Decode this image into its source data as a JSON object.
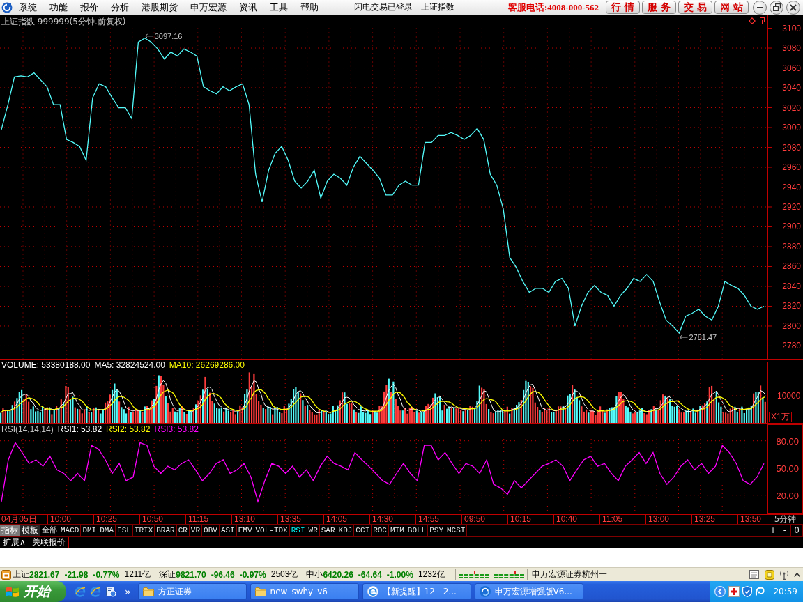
{
  "menu_bar": {
    "items": [
      "系统",
      "功能",
      "报价",
      "分析",
      "港股期货",
      "申万宏源",
      "资讯",
      "工具",
      "帮助"
    ],
    "status_texts": [
      "闪电交易已登录",
      "上证指数"
    ],
    "hotline": "客服电话:4008-000-562",
    "buttons": [
      "行 情",
      "服 务",
      "交 易",
      "网 站"
    ]
  },
  "price_panel": {
    "chart_data": {
      "type": "line",
      "title": "上证指数 999999(5分钟.前复权)",
      "series": [
        {
          "color": "#54fcfc",
          "values": [
            2998,
            3023,
            3051,
            3052,
            3051,
            3055,
            3048,
            3041,
            3023,
            3023,
            2988,
            2985,
            2981,
            2967,
            3030,
            3044,
            3041,
            3030,
            3020,
            3020,
            3009,
            3086,
            3090,
            3086,
            3079,
            3069,
            3076,
            3072,
            3079,
            3076,
            3072,
            3041,
            3037,
            3034,
            3041,
            3037,
            3041,
            3044,
            3023,
            2953,
            2925,
            2957,
            2974,
            2981,
            2967,
            2946,
            2939,
            2946,
            2957,
            2929,
            2946,
            2953,
            2949,
            2942,
            2960,
            2971,
            2964,
            2957,
            2949,
            2932,
            2932,
            2942,
            2946,
            2942,
            2942,
            2985,
            2985,
            2992,
            2992,
            2995,
            2992,
            2988,
            2992,
            2999,
            2988,
            2953,
            2942,
            2918,
            2869,
            2859,
            2845,
            2834,
            2838,
            2838,
            2834,
            2845,
            2848,
            2838,
            2800,
            2820,
            2834,
            2841,
            2834,
            2831,
            2820,
            2831,
            2838,
            2848,
            2845,
            2852,
            2845,
            2824,
            2806,
            2800,
            2793,
            2810,
            2813,
            2817,
            2810,
            2806,
            2820,
            2845,
            2841,
            2838,
            2831,
            2820,
            2817,
            2820
          ]
        }
      ],
      "ylim": [
        2767,
        3113
      ],
      "yticks": [
        3100,
        3080,
        3060,
        3040,
        3020,
        3000,
        2980,
        2960,
        2940,
        2920,
        2900,
        2880,
        2860,
        2840,
        2820,
        2800,
        2780
      ],
      "grid": true,
      "annotations": [
        "3097.16",
        "2781.47"
      ]
    }
  },
  "volume_panel": {
    "legend": [
      {
        "text": "VOLUME: 53380188.00",
        "color": "#ffffff"
      },
      {
        "text": "MA5: 32824524.00",
        "color": "#ffffff"
      },
      {
        "text": "MA10: 26269286.00",
        "color": "#ffff00"
      }
    ],
    "axis_label": "10000",
    "unit": "X1万"
  },
  "rsi_panel": {
    "legend": [
      {
        "text": "RSI(14,14,14)",
        "color": "#c0c0c0"
      },
      {
        "text": "RSI1: 53.82",
        "color": "#ffffff"
      },
      {
        "text": "RSI2: 53.82",
        "color": "#ffff00"
      },
      {
        "text": "RSI3: 53.82",
        "color": "#ff00ff"
      }
    ],
    "chart_data": {
      "type": "line",
      "series": [
        {
          "color": "#ff00ff",
          "values": [
            13,
            59,
            78,
            67,
            55,
            59,
            52,
            63,
            48,
            44,
            36,
            44,
            36,
            75,
            71,
            59,
            44,
            55,
            36,
            40,
            78,
            75,
            52,
            44,
            52,
            48,
            55,
            59,
            48,
            36,
            44,
            55,
            59,
            44,
            48,
            55,
            40,
            13,
            36,
            55,
            52,
            44,
            52,
            40,
            48,
            36,
            52,
            63,
            55,
            52,
            48,
            67,
            59,
            52,
            44,
            36,
            32,
            44,
            55,
            44,
            36,
            75,
            75,
            59,
            67,
            55,
            44,
            55,
            52,
            44,
            59,
            32,
            28,
            21,
            36,
            28,
            36,
            44,
            52,
            55,
            59,
            52,
            36,
            48,
            59,
            63,
            52,
            55,
            44,
            36,
            52,
            59,
            67,
            55,
            67,
            44,
            32,
            40,
            52,
            59,
            48,
            55,
            44,
            52,
            75,
            67,
            55,
            36,
            32,
            40,
            55
          ]
        }
      ],
      "ylim": [
        -1,
        99
      ],
      "yticks": [
        {
          "value": 80,
          "label": "80.00"
        },
        {
          "value": 50,
          "label": "50.00"
        },
        {
          "value": 20,
          "label": "20.00"
        }
      ],
      "grid": true
    }
  },
  "time_axis": {
    "labels": [
      "04月05日",
      "10:00",
      "10:25",
      "10:50",
      "11:15",
      "13:10",
      "13:35",
      "14:05",
      "14:30",
      "14:55",
      "09:50",
      "10:15",
      "10:40",
      "11:05",
      "13:00",
      "13:25",
      "13:50"
    ],
    "period": "5分钟"
  },
  "indicator_bar": {
    "modes": [
      {
        "label": "指标",
        "selected": true
      },
      {
        "label": "模板",
        "selected": false
      }
    ],
    "indicators": [
      {
        "label": "全部",
        "selected": false
      },
      {
        "label": "MACD",
        "selected": false
      },
      {
        "label": "DMI",
        "selected": false
      },
      {
        "label": "DMA",
        "selected": false
      },
      {
        "label": "FSL",
        "selected": false
      },
      {
        "label": "TRIX",
        "selected": false
      },
      {
        "label": "BRAR",
        "selected": false
      },
      {
        "label": "CR",
        "selected": false
      },
      {
        "label": "VR",
        "selected": false
      },
      {
        "label": "OBV",
        "selected": false
      },
      {
        "label": "ASI",
        "selected": false
      },
      {
        "label": "EMV",
        "selected": false
      },
      {
        "label": "VOL-TDX",
        "selected": false
      },
      {
        "label": "RSI",
        "selected": true
      },
      {
        "label": "WR",
        "selected": false
      },
      {
        "label": "SAR",
        "selected": false
      },
      {
        "label": "KDJ",
        "selected": false
      },
      {
        "label": "CCI",
        "selected": false
      },
      {
        "label": "ROC",
        "selected": false
      },
      {
        "label": "MTM",
        "selected": false
      },
      {
        "label": "BOLL",
        "selected": false
      },
      {
        "label": "PSY",
        "selected": false
      },
      {
        "label": "MCST",
        "selected": false
      }
    ],
    "zoom_buttons": [
      "+",
      "-",
      "0"
    ]
  },
  "panel_tabs": [
    "扩展∧",
    "关联报价"
  ],
  "status_bar": {
    "indices": [
      {
        "name": "上证",
        "price": "2821.67",
        "change": "-21.98",
        "percent": "-0.77%",
        "turnover": "1211亿"
      },
      {
        "name": "深证",
        "price": "9821.70",
        "change": "-96.46",
        "percent": "-0.97%",
        "turnover": "2503亿"
      },
      {
        "name": "中小",
        "price": "6420.26",
        "change": "-64.64",
        "percent": "-1.00%",
        "turnover": "1232亿"
      }
    ],
    "broker": "申万宏源证券杭州一"
  },
  "taskbar": {
    "start": "开始",
    "quick_launch_more": "»",
    "tasks": [
      {
        "label": "方正证券",
        "kind": "folder"
      },
      {
        "label": "new_swhy_v6",
        "kind": "folder"
      },
      {
        "label": "【新提醒】12 - 2...",
        "kind": "browser"
      },
      {
        "label": "申万宏源增强版V6...",
        "kind": "app"
      }
    ],
    "clock": "20:59"
  }
}
